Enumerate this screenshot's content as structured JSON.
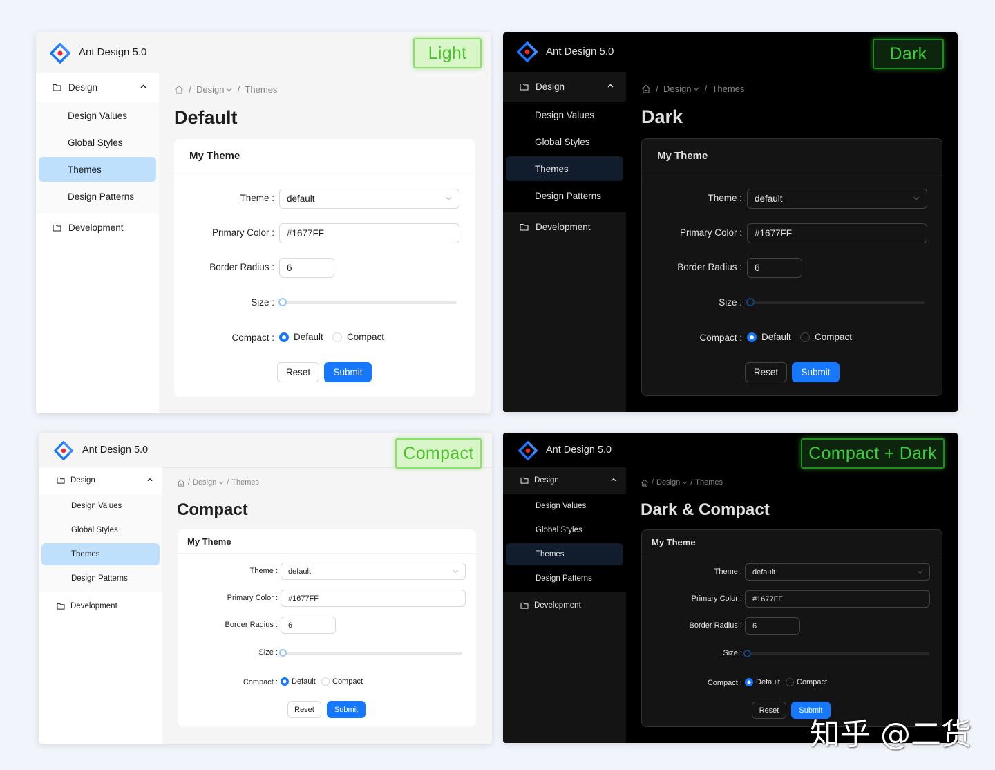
{
  "app_title": "Ant Design 5.0",
  "panel_labels": {
    "light": "Light",
    "dark": "Dark",
    "compact": "Compact",
    "compact_dark": "Compact + Dark"
  },
  "menu": {
    "design": "Design",
    "design_values": "Design Values",
    "global_styles": "Global Styles",
    "themes": "Themes",
    "design_patterns": "Design Patterns",
    "development": "Development"
  },
  "breadcrumb": {
    "separator": "/",
    "design": "Design",
    "themes": "Themes"
  },
  "page_titles": {
    "light": "Default",
    "dark": "Dark",
    "compact": "Compact",
    "compact_dark": "Dark & Compact"
  },
  "form": {
    "card_title": "My Theme",
    "theme_label": "Theme",
    "theme_value": "default",
    "primary_color_label": "Primary Color",
    "primary_color_value": "#1677FF",
    "border_radius_label": "Border Radius",
    "border_radius_value": "6",
    "size_label": "Size",
    "size_value": 0,
    "compact_label": "Compact",
    "compact_options": [
      "Default",
      "Compact"
    ],
    "compact_selected": "Default",
    "reset": "Reset",
    "submit": "Submit"
  },
  "colors": {
    "primary": "#1677FF",
    "label_green": "#4cc22a"
  },
  "icons": {
    "logo": "ant-design-logo-icon",
    "home": "home-icon",
    "folder": "folder-icon",
    "chevron_up": "chevron-up-icon",
    "chevron_down": "chevron-down-icon"
  },
  "watermark": "知乎 @二货"
}
